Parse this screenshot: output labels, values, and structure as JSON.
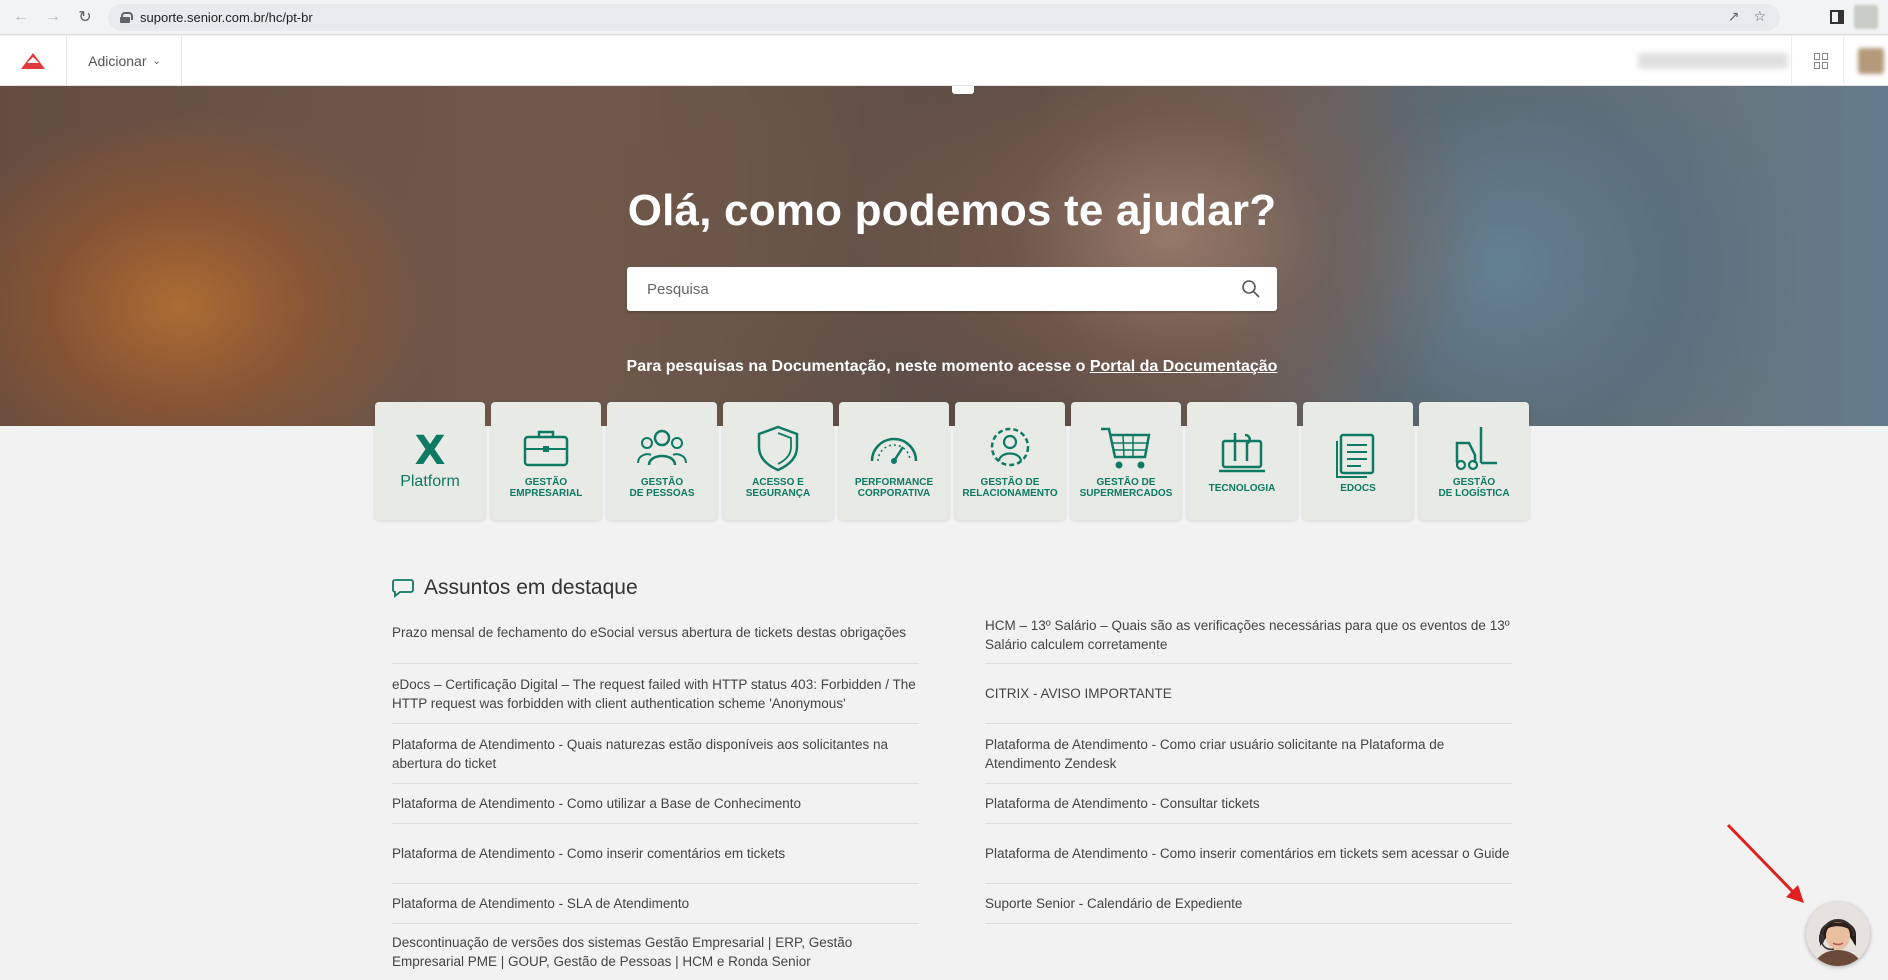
{
  "browser": {
    "url": "suporte.senior.com.br/hc/pt-br",
    "icons": [
      "back-arrow-icon",
      "forward-arrow-icon",
      "reload-icon",
      "lock-icon",
      "share-icon",
      "star-icon",
      "side-panel-icon"
    ]
  },
  "header": {
    "add_label": "Adicionar",
    "icons": [
      "senior-logo",
      "chevron-down-icon",
      "apps-grid-icon",
      "user-avatar"
    ]
  },
  "hero": {
    "title": "Olá, como podemos te ajudar?",
    "search_placeholder": "Pesquisa",
    "doc_note_text": "Para pesquisas na Documentação, neste momento acesse o ",
    "doc_note_link": "Portal da Documentação"
  },
  "products": [
    {
      "label": "Platform",
      "icon": "platform-x-icon"
    },
    {
      "label": "GESTÃO\nEMPRESARIAL",
      "icon": "briefcase-icon"
    },
    {
      "label": "GESTÃO\nDE PESSOAS",
      "icon": "people-icon"
    },
    {
      "label": "ACESSO E\nSEGURANÇA",
      "icon": "shield-icon"
    },
    {
      "label": "PERFORMANCE\nCORPORATIVA",
      "icon": "gauge-icon"
    },
    {
      "label": "GESTÃO DE\nRELACIONAMENTO",
      "icon": "gear-person-icon"
    },
    {
      "label": "GESTÃO DE\nSUPERMERCADOS",
      "icon": "shopping-cart-icon"
    },
    {
      "label": "TECNOLOGIA",
      "icon": "tools-icon"
    },
    {
      "label": "EDOCS",
      "icon": "document-icon"
    },
    {
      "label": "GESTÃO\nDE LOGÍSTICA",
      "icon": "forklift-icon"
    }
  ],
  "featured": {
    "title": "Assuntos em destaque",
    "left": [
      "Prazo mensal de fechamento do eSocial versus abertura de tickets destas obrigações",
      "eDocs – Certificação Digital – The request failed with HTTP status 403: Forbidden / The HTTP request was forbidden with client authentication scheme 'Anonymous'",
      "Plataforma de Atendimento - Quais naturezas estão disponíveis aos solicitantes na abertura do ticket",
      "Plataforma de Atendimento - Como utilizar a Base de Conhecimento",
      "Plataforma de Atendimento - Como inserir comentários em tickets",
      "Plataforma de Atendimento - SLA de Atendimento",
      "Descontinuação de versões dos sistemas Gestão Empresarial | ERP, Gestão Empresarial PME | GOUP, Gestão de Pessoas | HCM e Ronda Senior"
    ],
    "right": [
      "HCM – 13º Salário – Quais são as verificações necessárias para que os eventos de 13º Salário calculem corretamente",
      "CITRIX - AVISO IMPORTANTE",
      "Plataforma de Atendimento - Como criar usuário solicitante na Plataforma de Atendimento Zendesk",
      "Plataforma de Atendimento - Consultar tickets",
      "Plataforma de Atendimento - Como inserir comentários em tickets sem acessar o Guide",
      "Suporte Senior - Calendário de Expediente"
    ]
  },
  "colors": {
    "brand_green": "#0e7a63",
    "logo_red": "#e03a3a",
    "annotation_arrow": "#e02020"
  }
}
